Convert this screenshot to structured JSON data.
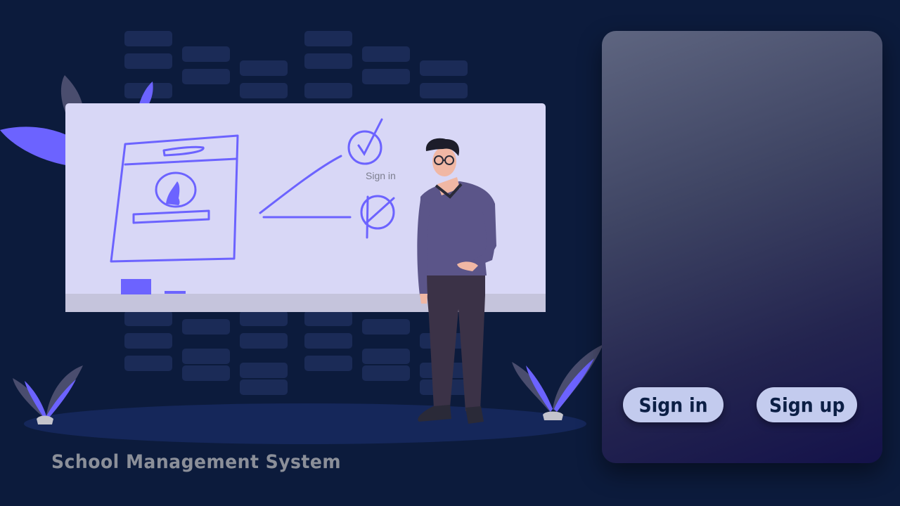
{
  "illustration": {
    "whiteboard_caption": "Sign in"
  },
  "app": {
    "title": "School Management System"
  },
  "panel": {
    "buttons": {
      "sign_in": "Sign in",
      "sign_up": "Sign up"
    }
  },
  "colors": {
    "background": "#0c1b3c",
    "accent": "#6c63ff",
    "button_bg": "#c3cbee",
    "button_text": "#0c1f45",
    "title_text": "#8b8f99"
  }
}
